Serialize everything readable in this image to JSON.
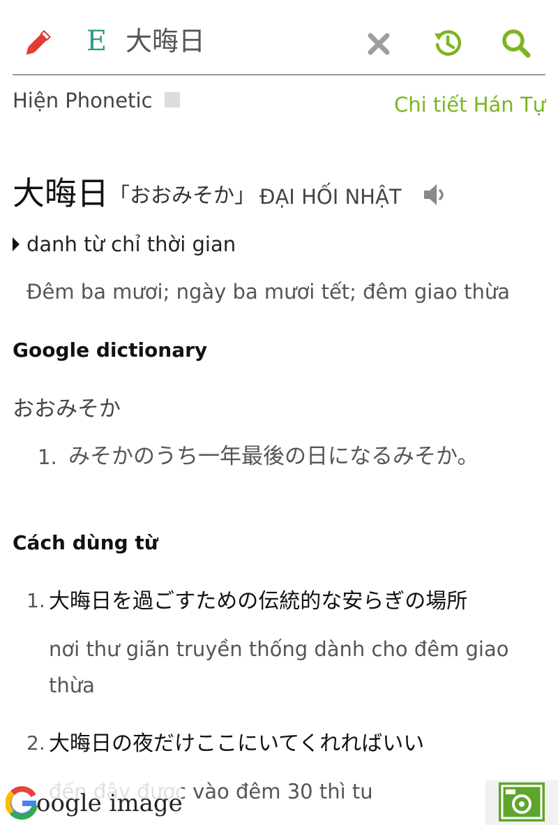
{
  "search_bar": {
    "language_indicator": "E",
    "query": "大晦日"
  },
  "options": {
    "phonetic_label": "Hiện Phonetic",
    "han_detail_link": "Chi tiết Hán Tự"
  },
  "entry": {
    "word": "大晦日",
    "reading": "「おおみそか」",
    "han_viet": "ĐẠI HỐI NHẬT",
    "part_of_speech": "danh từ chỉ thời gian",
    "meaning": "Đêm ba mươi; ngày ba mươi tết; đêm giao thừa"
  },
  "google_dictionary": {
    "title": "Google dictionary",
    "reading": "おおみそか",
    "definitions": [
      {
        "num": "1.",
        "text": "みそかのうち一年最後の日になるみそか。"
      }
    ]
  },
  "usage": {
    "title": "Cách dùng từ",
    "examples": [
      {
        "num": "1.",
        "jp": "大晦日を過ごすための伝統的な安らぎの場所",
        "vi": "nơi thư giãn truyền thống dành cho đêm giao thừa"
      },
      {
        "num": "2.",
        "jp": "大晦日の夜だけここにいてくれればいい",
        "vi": "đến đây được vào đêm 30 thì tu"
      }
    ]
  },
  "overlay": {
    "google_image_text": "oogle image"
  },
  "colors": {
    "accent_green": "#7cb51f",
    "pencil_red": "#e53935",
    "lang_teal": "#2e9c86"
  }
}
